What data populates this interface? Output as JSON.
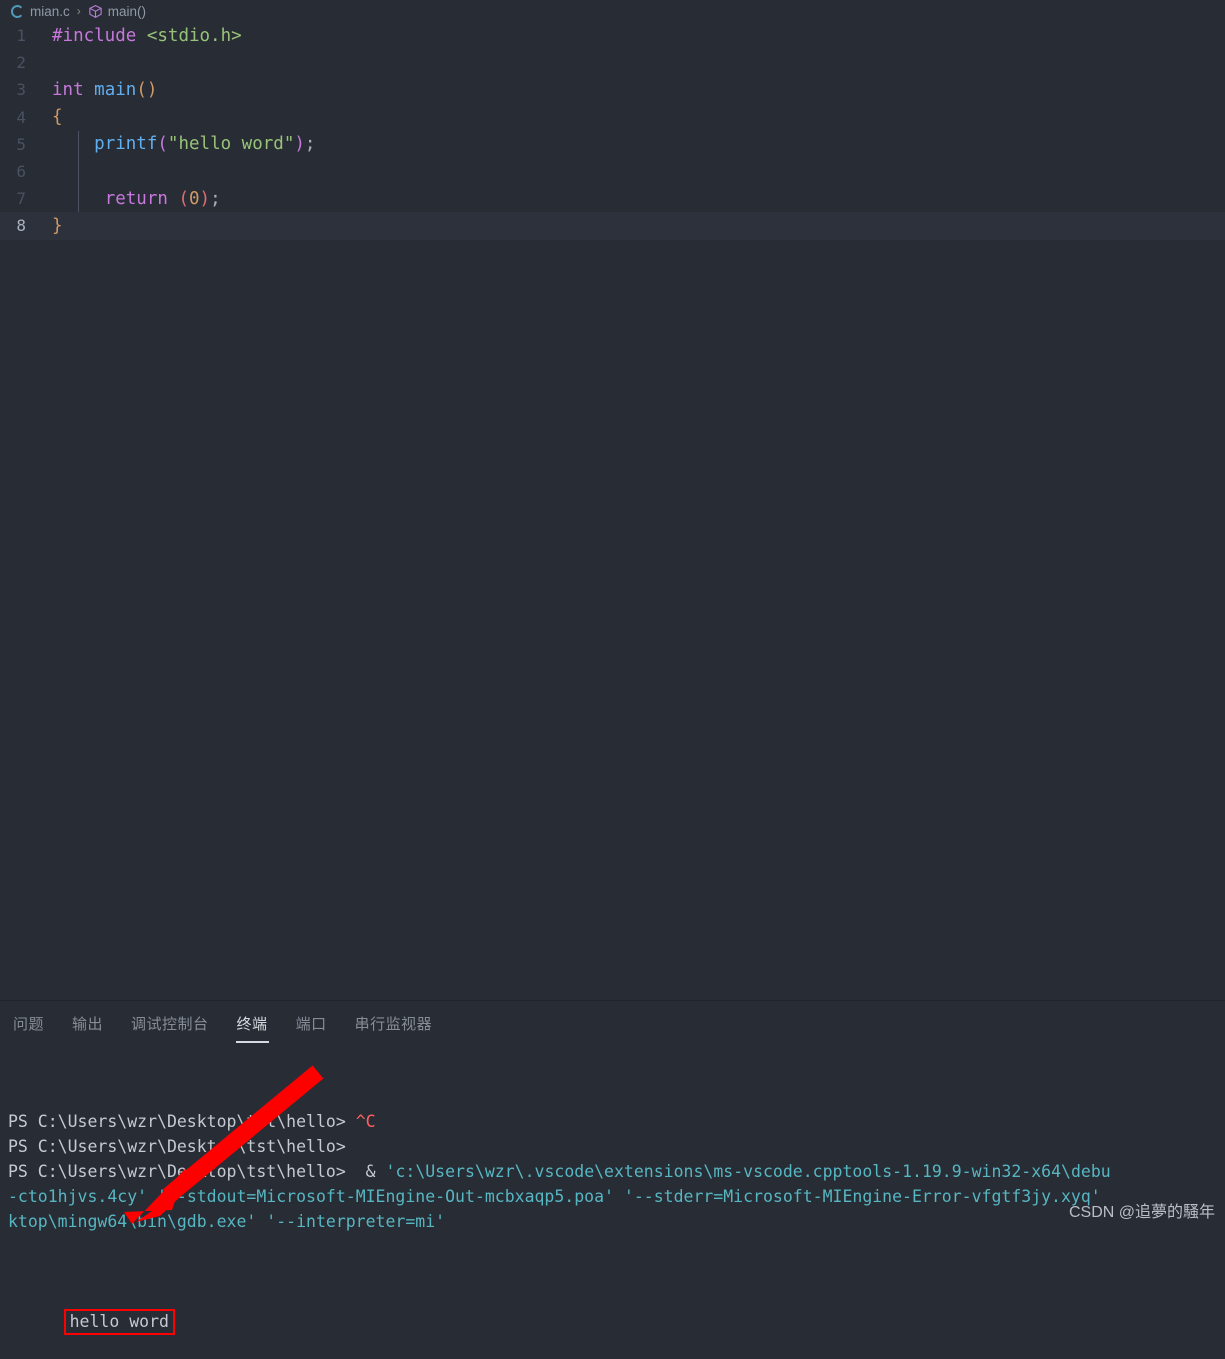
{
  "breadcrumb": {
    "file_icon": "c-file-icon",
    "file_name": "mian.c",
    "separator": "›",
    "symbol_icon": "cube-symbol-icon",
    "symbol_name": "main()"
  },
  "editor": {
    "language": "c",
    "active_line": 8,
    "lines": [
      {
        "number": "1",
        "tokens": [
          {
            "text": "#include",
            "color_class": "t-pre"
          },
          {
            "text": " ",
            "color_class": "t-punc"
          },
          {
            "text": "<stdio.h>",
            "color_class": "t-str"
          }
        ]
      },
      {
        "number": "2",
        "tokens": []
      },
      {
        "number": "3",
        "tokens": [
          {
            "text": "int",
            "color_class": "t-kw"
          },
          {
            "text": " ",
            "color_class": "t-punc"
          },
          {
            "text": "main",
            "color_class": "t-fn"
          },
          {
            "text": "()",
            "color_class": "t-paren1"
          }
        ]
      },
      {
        "number": "4",
        "tokens": [
          {
            "text": "{",
            "color_class": "t-brace"
          }
        ]
      },
      {
        "number": "5",
        "tokens": [
          {
            "text": "    ",
            "color_class": "t-punc"
          },
          {
            "text": "printf",
            "color_class": "t-fn"
          },
          {
            "text": "(",
            "color_class": "t-paren2"
          },
          {
            "text": "\"hello word\"",
            "color_class": "t-str"
          },
          {
            "text": ")",
            "color_class": "t-paren2"
          },
          {
            "text": ";",
            "color_class": "t-punc"
          }
        ]
      },
      {
        "number": "6",
        "tokens": []
      },
      {
        "number": "7",
        "tokens": [
          {
            "text": "     ",
            "color_class": "t-punc"
          },
          {
            "text": "return",
            "color_class": "t-kw"
          },
          {
            "text": " ",
            "color_class": "t-punc"
          },
          {
            "text": "(",
            "color_class": "t-paren3"
          },
          {
            "text": "0",
            "color_class": "t-num"
          },
          {
            "text": ")",
            "color_class": "t-paren3"
          },
          {
            "text": ";",
            "color_class": "t-punc"
          }
        ]
      },
      {
        "number": "8",
        "tokens": [
          {
            "text": "}",
            "color_class": "t-brace"
          }
        ]
      }
    ]
  },
  "panel": {
    "tabs": [
      {
        "label": "问题",
        "active": false
      },
      {
        "label": "输出",
        "active": false
      },
      {
        "label": "调试控制台",
        "active": false
      },
      {
        "label": "终端",
        "active": true
      },
      {
        "label": "端口",
        "active": false
      },
      {
        "label": "串行监视器",
        "active": false
      }
    ]
  },
  "terminal": {
    "prompt": "PS C:\\Users\\wzr\\Desktop\\tst\\hello>",
    "lines": [
      {
        "segments": [
          {
            "text": "PS C:\\Users\\wzr\\Desktop\\tst\\hello> ",
            "color_class": "c-default"
          },
          {
            "text": "^C",
            "color_class": "c-red"
          }
        ]
      },
      {
        "segments": [
          {
            "text": "PS C:\\Users\\wzr\\Desktop\\tst\\hello> ",
            "color_class": "c-default"
          }
        ]
      },
      {
        "segments": [
          {
            "text": "PS C:\\Users\\wzr\\Desktop\\tst\\hello>",
            "color_class": "c-default"
          },
          {
            "text": "  & ",
            "color_class": "c-default"
          },
          {
            "text": "'c:\\Users\\wzr\\.vscode\\extensions\\ms-vscode.cpptools-1.19.9-win32-x64\\debu",
            "color_class": "c-cyan"
          }
        ]
      },
      {
        "segments": [
          {
            "text": "-cto1hjvs.4cy' ",
            "color_class": "c-cyan"
          },
          {
            "text": "'--stdout=Microsoft-MIEngine-Out-mcbxaqp5.poa' '--stderr=Microsoft-MIEngine-Error-vfgtf3jy.xyq'",
            "color_class": "c-cyan"
          }
        ]
      },
      {
        "segments": [
          {
            "text": "ktop\\mingw64\\bin\\gdb.exe' '--interpreter=mi'",
            "color_class": "c-cyan"
          }
        ]
      }
    ],
    "program_output": "hello word",
    "output_highlight_color": "#ff0000"
  },
  "annotation": {
    "arrow_color": "#ff0000",
    "arrow_label": "red-arrow-pointing-to-output"
  },
  "watermark": {
    "text": "CSDN @追夢的騷年"
  }
}
